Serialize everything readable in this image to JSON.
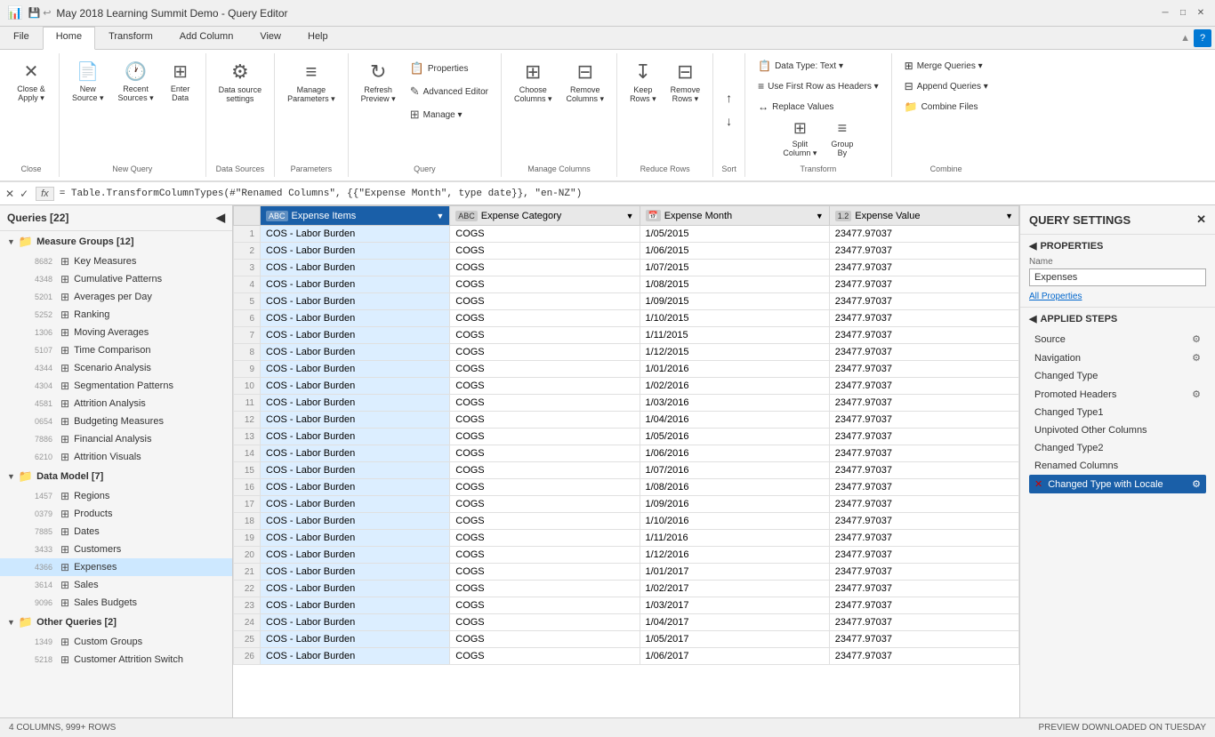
{
  "titleBar": {
    "icon": "📊",
    "title": "May 2018 Learning Summit Demo - Query Editor",
    "minimize": "─",
    "maximize": "□",
    "close": "✕"
  },
  "ribbonTabs": [
    "File",
    "Home",
    "Transform",
    "Add Column",
    "View",
    "Help"
  ],
  "activeTab": "Home",
  "ribbonGroups": {
    "close": {
      "label": "Close",
      "buttons": [
        {
          "id": "close-apply",
          "icon": "✕",
          "label": "Close &\nApply ▾",
          "hasDropdown": true
        }
      ]
    },
    "newQuery": {
      "label": "New Query",
      "buttons": [
        {
          "id": "new-source",
          "icon": "📄",
          "label": "New\nSource ▾"
        },
        {
          "id": "recent-sources",
          "icon": "🕐",
          "label": "Recent\nSources ▾"
        },
        {
          "id": "enter-data",
          "icon": "⊞",
          "label": "Enter\nData"
        }
      ]
    },
    "dataSources": {
      "label": "Data Sources",
      "buttons": [
        {
          "id": "data-source-settings",
          "icon": "⚙",
          "label": "Data source\nsettings"
        }
      ]
    },
    "parameters": {
      "label": "Parameters",
      "buttons": [
        {
          "id": "manage-parameters",
          "icon": "≡",
          "label": "Manage\nParameters ▾"
        }
      ]
    },
    "query": {
      "label": "Query",
      "buttons": [
        {
          "id": "refresh-preview",
          "icon": "↻",
          "label": "Refresh\nPreview ▾"
        },
        {
          "id": "properties",
          "label": "Properties"
        },
        {
          "id": "advanced-editor",
          "label": "Advanced Editor"
        },
        {
          "id": "manage",
          "label": "Manage ▾"
        }
      ]
    },
    "manageColumns": {
      "label": "Manage Columns",
      "buttons": [
        {
          "id": "choose-columns",
          "icon": "⊞",
          "label": "Choose\nColumns ▾"
        },
        {
          "id": "remove-columns",
          "icon": "⊟",
          "label": "Remove\nColumns ▾"
        }
      ]
    },
    "reduceRows": {
      "label": "Reduce Rows",
      "buttons": [
        {
          "id": "keep-rows",
          "icon": "↧",
          "label": "Keep\nRows ▾"
        },
        {
          "id": "remove-rows",
          "icon": "⊟",
          "label": "Remove\nRows ▾"
        }
      ]
    },
    "sort": {
      "label": "Sort",
      "buttons": [
        {
          "id": "sort-asc",
          "icon": "↑",
          "label": ""
        },
        {
          "id": "sort-desc",
          "icon": "↓",
          "label": ""
        }
      ]
    },
    "transform": {
      "label": "Transform",
      "items": [
        {
          "id": "data-type",
          "label": "Data Type: Text ▾"
        },
        {
          "id": "use-first-row",
          "label": "Use First Row as Headers ▾"
        },
        {
          "id": "replace-values",
          "label": "Replace Values"
        },
        {
          "id": "split-column",
          "icon": "⊞",
          "label": "Split\nColumn ▾"
        },
        {
          "id": "group-by",
          "icon": "≡",
          "label": "Group\nBy"
        }
      ]
    },
    "combine": {
      "label": "Combine",
      "items": [
        {
          "id": "merge-queries",
          "label": "Merge Queries ▾"
        },
        {
          "id": "append-queries",
          "label": "Append Queries ▾"
        },
        {
          "id": "combine-files",
          "label": "Combine Files"
        }
      ]
    }
  },
  "formulaBar": {
    "cancelBtn": "✕",
    "confirmBtn": "✓",
    "fxLabel": "fx",
    "formula": "= Table.TransformColumnTypes(#\"Renamed Columns\", {{\"Expense Month\", type date}}, \"en-NZ\")"
  },
  "sidebar": {
    "title": "Queries [22]",
    "collapseIcon": "◀",
    "groups": [
      {
        "id": "measure-groups",
        "label": "Measure Groups [12]",
        "expanded": true,
        "items": [
          {
            "id": "key-measures",
            "label": "Key Measures",
            "rowNum": "8682"
          },
          {
            "id": "cumulative-patterns",
            "label": "Cumulative Patterns",
            "rowNum": "4348"
          },
          {
            "id": "averages-per-day",
            "label": "Averages per Day",
            "rowNum": "5201"
          },
          {
            "id": "ranking",
            "label": "Ranking",
            "rowNum": "5252"
          },
          {
            "id": "moving-averages",
            "label": "Moving Averages",
            "rowNum": "1306"
          },
          {
            "id": "time-comparison",
            "label": "Time Comparison",
            "rowNum": "5107"
          },
          {
            "id": "scenario-analysis",
            "label": "Scenario Analysis",
            "rowNum": "4344"
          },
          {
            "id": "segmentation-patterns",
            "label": "Segmentation Patterns",
            "rowNum": "4304"
          },
          {
            "id": "attrition-analysis",
            "label": "Attrition Analysis",
            "rowNum": "4581"
          },
          {
            "id": "budgeting-measures",
            "label": "Budgeting Measures",
            "rowNum": "0654"
          },
          {
            "id": "financial-analysis",
            "label": "Financial Analysis",
            "rowNum": "7886"
          },
          {
            "id": "attrition-visuals",
            "label": "Attrition Visuals",
            "rowNum": "6210"
          }
        ]
      },
      {
        "id": "data-model",
        "label": "Data Model [7]",
        "expanded": true,
        "items": [
          {
            "id": "regions",
            "label": "Regions",
            "rowNum": "1457"
          },
          {
            "id": "products",
            "label": "Products",
            "rowNum": "0379"
          },
          {
            "id": "dates",
            "label": "Dates",
            "rowNum": "7885"
          },
          {
            "id": "customers",
            "label": "Customers",
            "rowNum": "3433"
          },
          {
            "id": "expenses",
            "label": "Expenses",
            "rowNum": "4366",
            "active": true
          },
          {
            "id": "sales",
            "label": "Sales",
            "rowNum": "3614"
          },
          {
            "id": "sales-budgets",
            "label": "Sales Budgets",
            "rowNum": "9096"
          }
        ]
      },
      {
        "id": "other-queries",
        "label": "Other Queries [2]",
        "expanded": true,
        "items": [
          {
            "id": "custom-groups",
            "label": "Custom Groups",
            "rowNum": "1349"
          },
          {
            "id": "customer-attrition-switch",
            "label": "Customer Attrition Switch",
            "rowNum": "5218"
          }
        ]
      }
    ]
  },
  "grid": {
    "columns": [
      {
        "id": "expense-items",
        "label": "Expense Items",
        "type": "ABC",
        "typeIcon": "ABC",
        "selected": true
      },
      {
        "id": "expense-category",
        "label": "Expense Category",
        "type": "ABC",
        "typeIcon": "ABC",
        "selected": false
      },
      {
        "id": "expense-month",
        "label": "Expense Month",
        "type": "📅",
        "typeIcon": "📅",
        "selected": false
      },
      {
        "id": "expense-value",
        "label": "Expense Value",
        "type": "1.2",
        "typeIcon": "1.2",
        "selected": false
      }
    ],
    "rows": [
      {
        "num": 1,
        "expenseItems": "COS - Labor Burden",
        "expenseCategory": "COGS",
        "expenseMonth": "1/05/2015",
        "expenseValue": "23477.97037"
      },
      {
        "num": 2,
        "expenseItems": "COS - Labor Burden",
        "expenseCategory": "COGS",
        "expenseMonth": "1/06/2015",
        "expenseValue": "23477.97037"
      },
      {
        "num": 3,
        "expenseItems": "COS - Labor Burden",
        "expenseCategory": "COGS",
        "expenseMonth": "1/07/2015",
        "expenseValue": "23477.97037"
      },
      {
        "num": 4,
        "expenseItems": "COS - Labor Burden",
        "expenseCategory": "COGS",
        "expenseMonth": "1/08/2015",
        "expenseValue": "23477.97037"
      },
      {
        "num": 5,
        "expenseItems": "COS - Labor Burden",
        "expenseCategory": "COGS",
        "expenseMonth": "1/09/2015",
        "expenseValue": "23477.97037"
      },
      {
        "num": 6,
        "expenseItems": "COS - Labor Burden",
        "expenseCategory": "COGS",
        "expenseMonth": "1/10/2015",
        "expenseValue": "23477.97037"
      },
      {
        "num": 7,
        "expenseItems": "COS - Labor Burden",
        "expenseCategory": "COGS",
        "expenseMonth": "1/11/2015",
        "expenseValue": "23477.97037"
      },
      {
        "num": 8,
        "expenseItems": "COS - Labor Burden",
        "expenseCategory": "COGS",
        "expenseMonth": "1/12/2015",
        "expenseValue": "23477.97037"
      },
      {
        "num": 9,
        "expenseItems": "COS - Labor Burden",
        "expenseCategory": "COGS",
        "expenseMonth": "1/01/2016",
        "expenseValue": "23477.97037"
      },
      {
        "num": 10,
        "expenseItems": "COS - Labor Burden",
        "expenseCategory": "COGS",
        "expenseMonth": "1/02/2016",
        "expenseValue": "23477.97037"
      },
      {
        "num": 11,
        "expenseItems": "COS - Labor Burden",
        "expenseCategory": "COGS",
        "expenseMonth": "1/03/2016",
        "expenseValue": "23477.97037"
      },
      {
        "num": 12,
        "expenseItems": "COS - Labor Burden",
        "expenseCategory": "COGS",
        "expenseMonth": "1/04/2016",
        "expenseValue": "23477.97037"
      },
      {
        "num": 13,
        "expenseItems": "COS - Labor Burden",
        "expenseCategory": "COGS",
        "expenseMonth": "1/05/2016",
        "expenseValue": "23477.97037"
      },
      {
        "num": 14,
        "expenseItems": "COS - Labor Burden",
        "expenseCategory": "COGS",
        "expenseMonth": "1/06/2016",
        "expenseValue": "23477.97037"
      },
      {
        "num": 15,
        "expenseItems": "COS - Labor Burden",
        "expenseCategory": "COGS",
        "expenseMonth": "1/07/2016",
        "expenseValue": "23477.97037"
      },
      {
        "num": 16,
        "expenseItems": "COS - Labor Burden",
        "expenseCategory": "COGS",
        "expenseMonth": "1/08/2016",
        "expenseValue": "23477.97037"
      },
      {
        "num": 17,
        "expenseItems": "COS - Labor Burden",
        "expenseCategory": "COGS",
        "expenseMonth": "1/09/2016",
        "expenseValue": "23477.97037"
      },
      {
        "num": 18,
        "expenseItems": "COS - Labor Burden",
        "expenseCategory": "COGS",
        "expenseMonth": "1/10/2016",
        "expenseValue": "23477.97037"
      },
      {
        "num": 19,
        "expenseItems": "COS - Labor Burden",
        "expenseCategory": "COGS",
        "expenseMonth": "1/11/2016",
        "expenseValue": "23477.97037"
      },
      {
        "num": 20,
        "expenseItems": "COS - Labor Burden",
        "expenseCategory": "COGS",
        "expenseMonth": "1/12/2016",
        "expenseValue": "23477.97037"
      },
      {
        "num": 21,
        "expenseItems": "COS - Labor Burden",
        "expenseCategory": "COGS",
        "expenseMonth": "1/01/2017",
        "expenseValue": "23477.97037"
      },
      {
        "num": 22,
        "expenseItems": "COS - Labor Burden",
        "expenseCategory": "COGS",
        "expenseMonth": "1/02/2017",
        "expenseValue": "23477.97037"
      },
      {
        "num": 23,
        "expenseItems": "COS - Labor Burden",
        "expenseCategory": "COGS",
        "expenseMonth": "1/03/2017",
        "expenseValue": "23477.97037"
      },
      {
        "num": 24,
        "expenseItems": "COS - Labor Burden",
        "expenseCategory": "COGS",
        "expenseMonth": "1/04/2017",
        "expenseValue": "23477.97037"
      },
      {
        "num": 25,
        "expenseItems": "COS - Labor Burden",
        "expenseCategory": "COGS",
        "expenseMonth": "1/05/2017",
        "expenseValue": "23477.97037"
      },
      {
        "num": 26,
        "expenseItems": "COS - Labor Burden",
        "expenseCategory": "COGS",
        "expenseMonth": "1/06/2017",
        "expenseValue": "23477.97037"
      }
    ]
  },
  "querySettings": {
    "title": "QUERY SETTINGS",
    "closeBtn": "✕",
    "properties": {
      "header": "PROPERTIES",
      "nameLabel": "Name",
      "nameValue": "Expenses",
      "allPropertiesLink": "All Properties"
    },
    "appliedSteps": {
      "header": "APPLIED STEPS",
      "steps": [
        {
          "id": "source",
          "label": "Source",
          "hasGear": true
        },
        {
          "id": "navigation",
          "label": "Navigation",
          "hasGear": true
        },
        {
          "id": "changed-type",
          "label": "Changed Type",
          "hasGear": false
        },
        {
          "id": "promoted-headers",
          "label": "Promoted Headers",
          "hasGear": true
        },
        {
          "id": "changed-type1",
          "label": "Changed Type1",
          "hasGear": false
        },
        {
          "id": "unpivoted-other-columns",
          "label": "Unpivoted Other Columns",
          "hasGear": false
        },
        {
          "id": "changed-type2",
          "label": "Changed Type2",
          "hasGear": false
        },
        {
          "id": "renamed-columns",
          "label": "Renamed Columns",
          "hasGear": false
        },
        {
          "id": "changed-type-with-locale",
          "label": "Changed Type with Locale",
          "hasGear": true,
          "active": true,
          "hasError": true
        }
      ]
    }
  },
  "statusBar": {
    "rowColInfo": "4 COLUMNS, 999+ ROWS",
    "previewInfo": "PREVIEW DOWNLOADED ON TUESDAY"
  }
}
